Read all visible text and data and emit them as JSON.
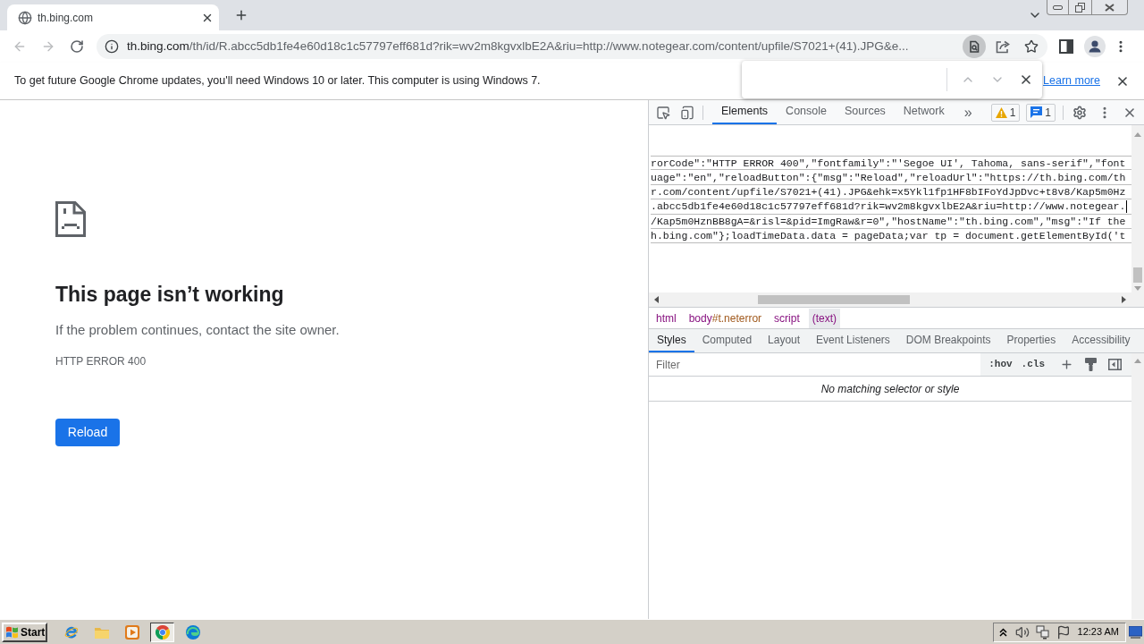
{
  "window": {
    "tabs": [
      {
        "title": "th.bing.com",
        "selected": true
      }
    ]
  },
  "toolbar": {
    "back_disabled": true,
    "forward_disabled": true,
    "address_host": "th.bing.com",
    "address_path": "/th/id/R.abcc5db1fe4e60d18c1c57797eff681d?rik=wv2m8kgvxlbE2A&riu=http://www.notegear.com/content/upfile/S7021+(41).JPG&e..."
  },
  "info_bar": {
    "message": "To get future Google Chrome updates, you'll need Windows 10 or later. This computer is using Windows 7.",
    "link": "Learn more"
  },
  "find_bar": {
    "navigation_disabled": true
  },
  "page": {
    "title": "This page isn’t working",
    "message": "If the problem continues, contact the site owner.",
    "error_code": "HTTP ERROR 400",
    "button": "Reload"
  },
  "devtools": {
    "tabs": [
      {
        "label": "Elements",
        "selected": true
      },
      {
        "label": "Console",
        "selected": false
      },
      {
        "label": "Sources",
        "selected": false
      },
      {
        "label": "Network",
        "selected": false
      }
    ],
    "more_tabs": "»",
    "warning_count": "1",
    "message_count": "1",
    "code_lines": [
      {
        "text": "rorCode\":\"HTTP ERROR 400\",\"fontfamily\":\"'Segoe UI', Tahoma, sans-serif\",\"font",
        "cursor": false
      },
      {
        "text": "uage\":\"en\",\"reloadButton\":{\"msg\":\"Reload\",\"reloadUrl\":\"https://th.bing.com/th",
        "cursor": false
      },
      {
        "text": "r.com/content/upfile/S7021+(41).JPG&ehk=x5Ykl1fp1HF8bIFoYdJpDvc+t8v8/Kap5m0Hz",
        "cursor": false
      },
      {
        "text": ".abcc5db1fe4e60d18c1c57797eff681d?rik=wv2m8kgvxlbE2A&riu=http://www.notegear.",
        "cursor": true
      },
      {
        "text": "/Kap5m0HznBB8gA=&risl=&pid=ImgRaw&r=0\",\"hostName\":\"th.bing.com\",\"msg\":\"If the",
        "cursor": false
      },
      {
        "text": "h.bing.com\"};loadTimeData.data = pageData;var tp = document.getElementById('t",
        "cursor": false
      }
    ],
    "breadcrumbs": [
      {
        "tag": "html",
        "selected": false
      },
      {
        "tag": "body",
        "attrs": "#t.neterror",
        "selected": false
      },
      {
        "tag": "script",
        "selected": false
      },
      {
        "tag": "(text)",
        "selected": true
      }
    ],
    "sidebar_tabs": [
      {
        "label": "Styles",
        "selected": true
      },
      {
        "label": "Computed",
        "selected": false
      },
      {
        "label": "Layout",
        "selected": false
      },
      {
        "label": "Event Listeners",
        "selected": false
      },
      {
        "label": "DOM Breakpoints",
        "selected": false
      },
      {
        "label": "Properties",
        "selected": false
      },
      {
        "label": "Accessibility",
        "selected": false
      }
    ],
    "filter": {
      "placeholder": "Filter",
      "toggles": [
        ":hov",
        ".cls"
      ]
    },
    "empty_message": "No matching selector or style"
  },
  "taskbar": {
    "start": "Start",
    "apps": [
      {
        "kind": "ie",
        "selected": false
      },
      {
        "kind": "explorer",
        "selected": false
      },
      {
        "kind": "media",
        "selected": false
      },
      {
        "kind": "chrome",
        "selected": true
      },
      {
        "kind": "edge",
        "selected": false
      }
    ],
    "clock": "12:23 AM"
  }
}
